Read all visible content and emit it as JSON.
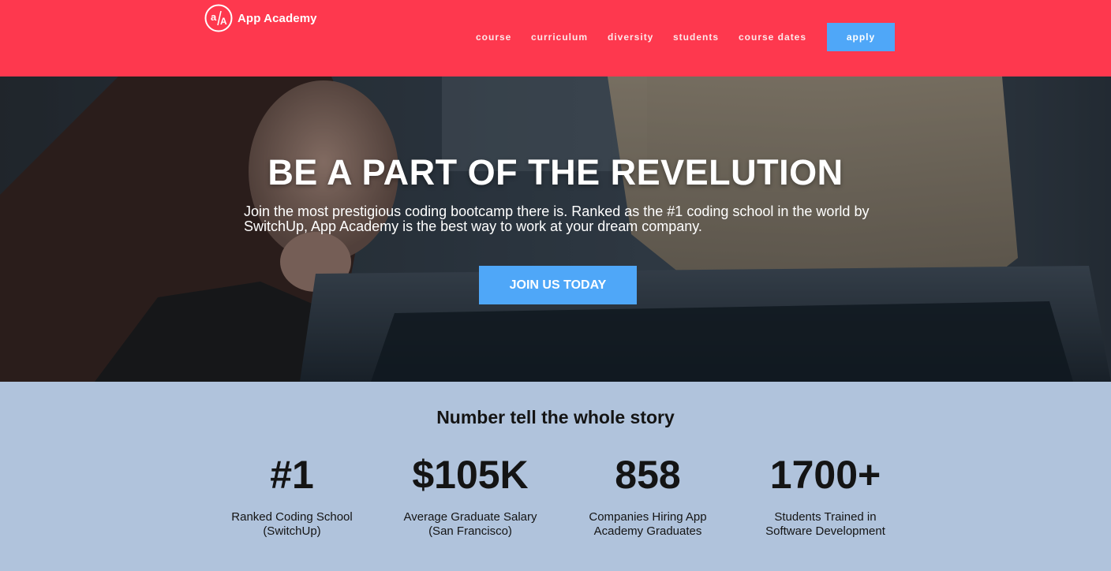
{
  "brand": {
    "name": "App Academy",
    "logo_text": "a/A"
  },
  "nav": {
    "links": [
      "course",
      "curriculum",
      "diversity",
      "students",
      "course dates"
    ],
    "apply_label": "apply"
  },
  "hero": {
    "title": "BE A PART OF THE REVELUTION",
    "subtitle": "Join the most prestigious coding bootcamp there is. Ranked as the #1 coding school in the world by SwitchUp, App Academy is the best way to work at your dream company.",
    "cta_label": "JOIN US TODAY"
  },
  "stats": {
    "title": "Number tell the whole story",
    "items": [
      {
        "value": "#1",
        "label_line1": "Ranked Coding School",
        "label_line2": "(SwitchUp)"
      },
      {
        "value": "$105K",
        "label_line1": "Average Graduate Salary",
        "label_line2": "(San Francisco)"
      },
      {
        "value": "858",
        "label_line1": "Companies Hiring App",
        "label_line2": "Academy Graduates"
      },
      {
        "value": "1700+",
        "label_line1": "Students Trained in",
        "label_line2": "Software Development"
      }
    ]
  },
  "colors": {
    "header_bg": "#fe384e",
    "accent_button": "#4fa7f8",
    "stats_bg": "#b0c3dc"
  }
}
